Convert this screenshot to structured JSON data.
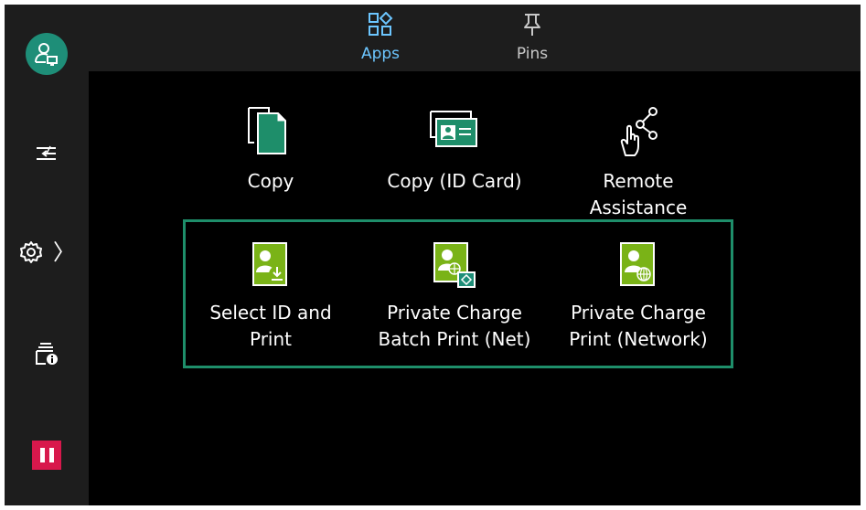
{
  "colors": {
    "accent_teal": "#1e8e78",
    "tab_active": "#6cc6ff",
    "pause_red": "#d8184c",
    "highlight_border": "#1e8e6a",
    "doc_green": "#7ab317"
  },
  "sidebar": {
    "items": [
      {
        "name": "user-login",
        "icon": "user-monitor-icon"
      },
      {
        "name": "job-status",
        "icon": "job-flow-icon"
      },
      {
        "name": "device-settings",
        "icon": "gear-icon",
        "has_chevron": true,
        "chevron": "〉"
      },
      {
        "name": "device-info",
        "icon": "printer-info-icon"
      },
      {
        "name": "pause",
        "icon": "pause-icon"
      }
    ]
  },
  "topbar": {
    "tabs": [
      {
        "label": "Apps",
        "icon": "apps-grid-icon",
        "active": true
      },
      {
        "label": "Pins",
        "icon": "pin-icon",
        "active": false
      }
    ]
  },
  "apps": {
    "row1": [
      {
        "label": "Copy",
        "icon": "copy-icon"
      },
      {
        "label": "Copy (ID Card)",
        "icon": "id-card-copy-icon"
      },
      {
        "label": "Remote\nAssistance",
        "icon": "remote-assistance-icon"
      }
    ],
    "row2": [
      {
        "label": "Select ID and\nPrint",
        "icon": "select-id-print-icon"
      },
      {
        "label": "Private Charge\nBatch Print (Net)",
        "icon": "private-batch-print-icon"
      },
      {
        "label": "Private Charge\nPrint (Network)",
        "icon": "private-network-print-icon"
      }
    ]
  }
}
